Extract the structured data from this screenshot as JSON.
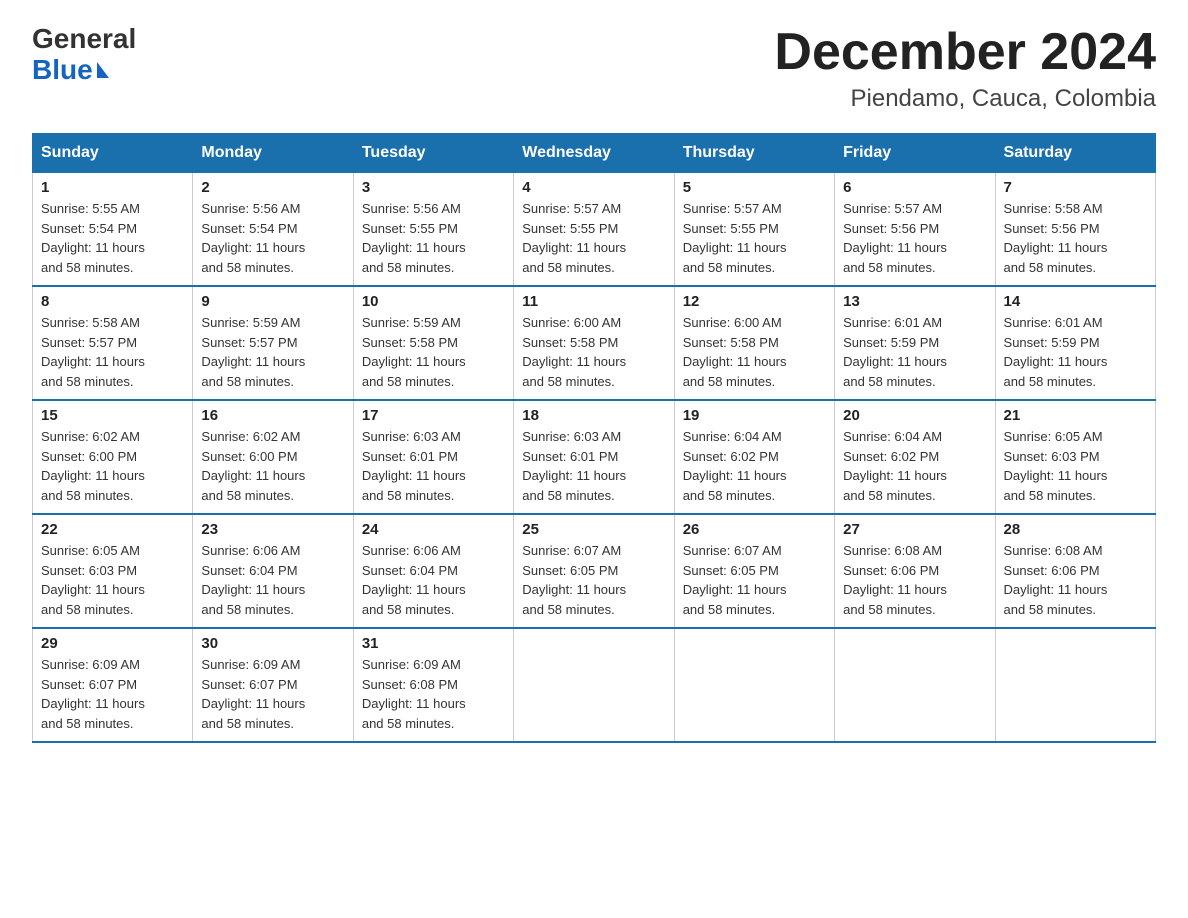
{
  "logo": {
    "general": "General",
    "blue": "Blue"
  },
  "header": {
    "month_year": "December 2024",
    "location": "Piendamo, Cauca, Colombia"
  },
  "days_of_week": [
    "Sunday",
    "Monday",
    "Tuesday",
    "Wednesday",
    "Thursday",
    "Friday",
    "Saturday"
  ],
  "weeks": [
    [
      {
        "day": "1",
        "sunrise": "5:55 AM",
        "sunset": "5:54 PM",
        "daylight": "11 hours and 58 minutes."
      },
      {
        "day": "2",
        "sunrise": "5:56 AM",
        "sunset": "5:54 PM",
        "daylight": "11 hours and 58 minutes."
      },
      {
        "day": "3",
        "sunrise": "5:56 AM",
        "sunset": "5:55 PM",
        "daylight": "11 hours and 58 minutes."
      },
      {
        "day": "4",
        "sunrise": "5:57 AM",
        "sunset": "5:55 PM",
        "daylight": "11 hours and 58 minutes."
      },
      {
        "day": "5",
        "sunrise": "5:57 AM",
        "sunset": "5:55 PM",
        "daylight": "11 hours and 58 minutes."
      },
      {
        "day": "6",
        "sunrise": "5:57 AM",
        "sunset": "5:56 PM",
        "daylight": "11 hours and 58 minutes."
      },
      {
        "day": "7",
        "sunrise": "5:58 AM",
        "sunset": "5:56 PM",
        "daylight": "11 hours and 58 minutes."
      }
    ],
    [
      {
        "day": "8",
        "sunrise": "5:58 AM",
        "sunset": "5:57 PM",
        "daylight": "11 hours and 58 minutes."
      },
      {
        "day": "9",
        "sunrise": "5:59 AM",
        "sunset": "5:57 PM",
        "daylight": "11 hours and 58 minutes."
      },
      {
        "day": "10",
        "sunrise": "5:59 AM",
        "sunset": "5:58 PM",
        "daylight": "11 hours and 58 minutes."
      },
      {
        "day": "11",
        "sunrise": "6:00 AM",
        "sunset": "5:58 PM",
        "daylight": "11 hours and 58 minutes."
      },
      {
        "day": "12",
        "sunrise": "6:00 AM",
        "sunset": "5:58 PM",
        "daylight": "11 hours and 58 minutes."
      },
      {
        "day": "13",
        "sunrise": "6:01 AM",
        "sunset": "5:59 PM",
        "daylight": "11 hours and 58 minutes."
      },
      {
        "day": "14",
        "sunrise": "6:01 AM",
        "sunset": "5:59 PM",
        "daylight": "11 hours and 58 minutes."
      }
    ],
    [
      {
        "day": "15",
        "sunrise": "6:02 AM",
        "sunset": "6:00 PM",
        "daylight": "11 hours and 58 minutes."
      },
      {
        "day": "16",
        "sunrise": "6:02 AM",
        "sunset": "6:00 PM",
        "daylight": "11 hours and 58 minutes."
      },
      {
        "day": "17",
        "sunrise": "6:03 AM",
        "sunset": "6:01 PM",
        "daylight": "11 hours and 58 minutes."
      },
      {
        "day": "18",
        "sunrise": "6:03 AM",
        "sunset": "6:01 PM",
        "daylight": "11 hours and 58 minutes."
      },
      {
        "day": "19",
        "sunrise": "6:04 AM",
        "sunset": "6:02 PM",
        "daylight": "11 hours and 58 minutes."
      },
      {
        "day": "20",
        "sunrise": "6:04 AM",
        "sunset": "6:02 PM",
        "daylight": "11 hours and 58 minutes."
      },
      {
        "day": "21",
        "sunrise": "6:05 AM",
        "sunset": "6:03 PM",
        "daylight": "11 hours and 58 minutes."
      }
    ],
    [
      {
        "day": "22",
        "sunrise": "6:05 AM",
        "sunset": "6:03 PM",
        "daylight": "11 hours and 58 minutes."
      },
      {
        "day": "23",
        "sunrise": "6:06 AM",
        "sunset": "6:04 PM",
        "daylight": "11 hours and 58 minutes."
      },
      {
        "day": "24",
        "sunrise": "6:06 AM",
        "sunset": "6:04 PM",
        "daylight": "11 hours and 58 minutes."
      },
      {
        "day": "25",
        "sunrise": "6:07 AM",
        "sunset": "6:05 PM",
        "daylight": "11 hours and 58 minutes."
      },
      {
        "day": "26",
        "sunrise": "6:07 AM",
        "sunset": "6:05 PM",
        "daylight": "11 hours and 58 minutes."
      },
      {
        "day": "27",
        "sunrise": "6:08 AM",
        "sunset": "6:06 PM",
        "daylight": "11 hours and 58 minutes."
      },
      {
        "day": "28",
        "sunrise": "6:08 AM",
        "sunset": "6:06 PM",
        "daylight": "11 hours and 58 minutes."
      }
    ],
    [
      {
        "day": "29",
        "sunrise": "6:09 AM",
        "sunset": "6:07 PM",
        "daylight": "11 hours and 58 minutes."
      },
      {
        "day": "30",
        "sunrise": "6:09 AM",
        "sunset": "6:07 PM",
        "daylight": "11 hours and 58 minutes."
      },
      {
        "day": "31",
        "sunrise": "6:09 AM",
        "sunset": "6:08 PM",
        "daylight": "11 hours and 58 minutes."
      },
      null,
      null,
      null,
      null
    ]
  ],
  "labels": {
    "sunrise": "Sunrise:",
    "sunset": "Sunset:",
    "daylight": "Daylight:"
  }
}
